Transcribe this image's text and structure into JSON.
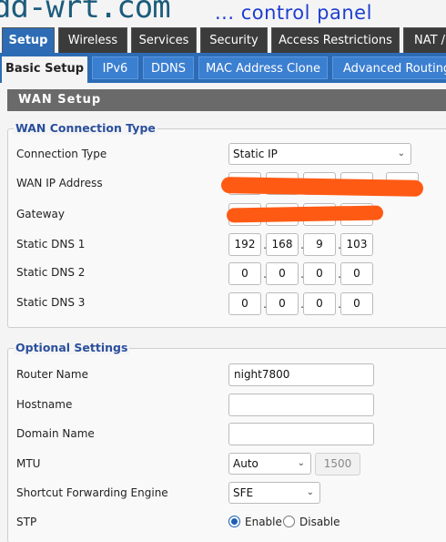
{
  "header": {
    "logo": "dd-wrt.com",
    "tagline": "... control panel"
  },
  "main_tabs": [
    "Setup",
    "Wireless",
    "Services",
    "Security",
    "Access Restrictions",
    "NAT /"
  ],
  "sub_tabs": [
    "Basic Setup",
    "IPv6",
    "DDNS",
    "MAC Address Clone",
    "Advanced Routing"
  ],
  "section_title": "WAN Setup",
  "wan_connection": {
    "legend": "WAN Connection Type",
    "connection_type_label": "Connection Type",
    "connection_type_value": "Static IP",
    "wan_ip_label": "WAN IP Address",
    "gateway_label": "Gateway",
    "dns1_label": "Static DNS 1",
    "dns1": [
      "192",
      "168",
      "9",
      "103"
    ],
    "dns2_label": "Static DNS 2",
    "dns2": [
      "0",
      "0",
      "0",
      "0"
    ],
    "dns3_label": "Static DNS 3",
    "dns3": [
      "0",
      "0",
      "0",
      "0"
    ]
  },
  "optional": {
    "legend": "Optional Settings",
    "router_name_label": "Router Name",
    "router_name_value": "night7800",
    "hostname_label": "Hostname",
    "hostname_value": "",
    "domain_label": "Domain Name",
    "domain_value": "",
    "mtu_label": "MTU",
    "mtu_mode": "Auto",
    "mtu_value": "1500",
    "sfe_label": "Shortcut Forwarding Engine",
    "sfe_value": "SFE",
    "stp_label": "STP",
    "stp_enable": "Enable",
    "stp_disable": "Disable"
  },
  "colors": {
    "accent": "#2d6cb4",
    "redaction": "#ff5a14",
    "legend": "#2a4f9c"
  }
}
